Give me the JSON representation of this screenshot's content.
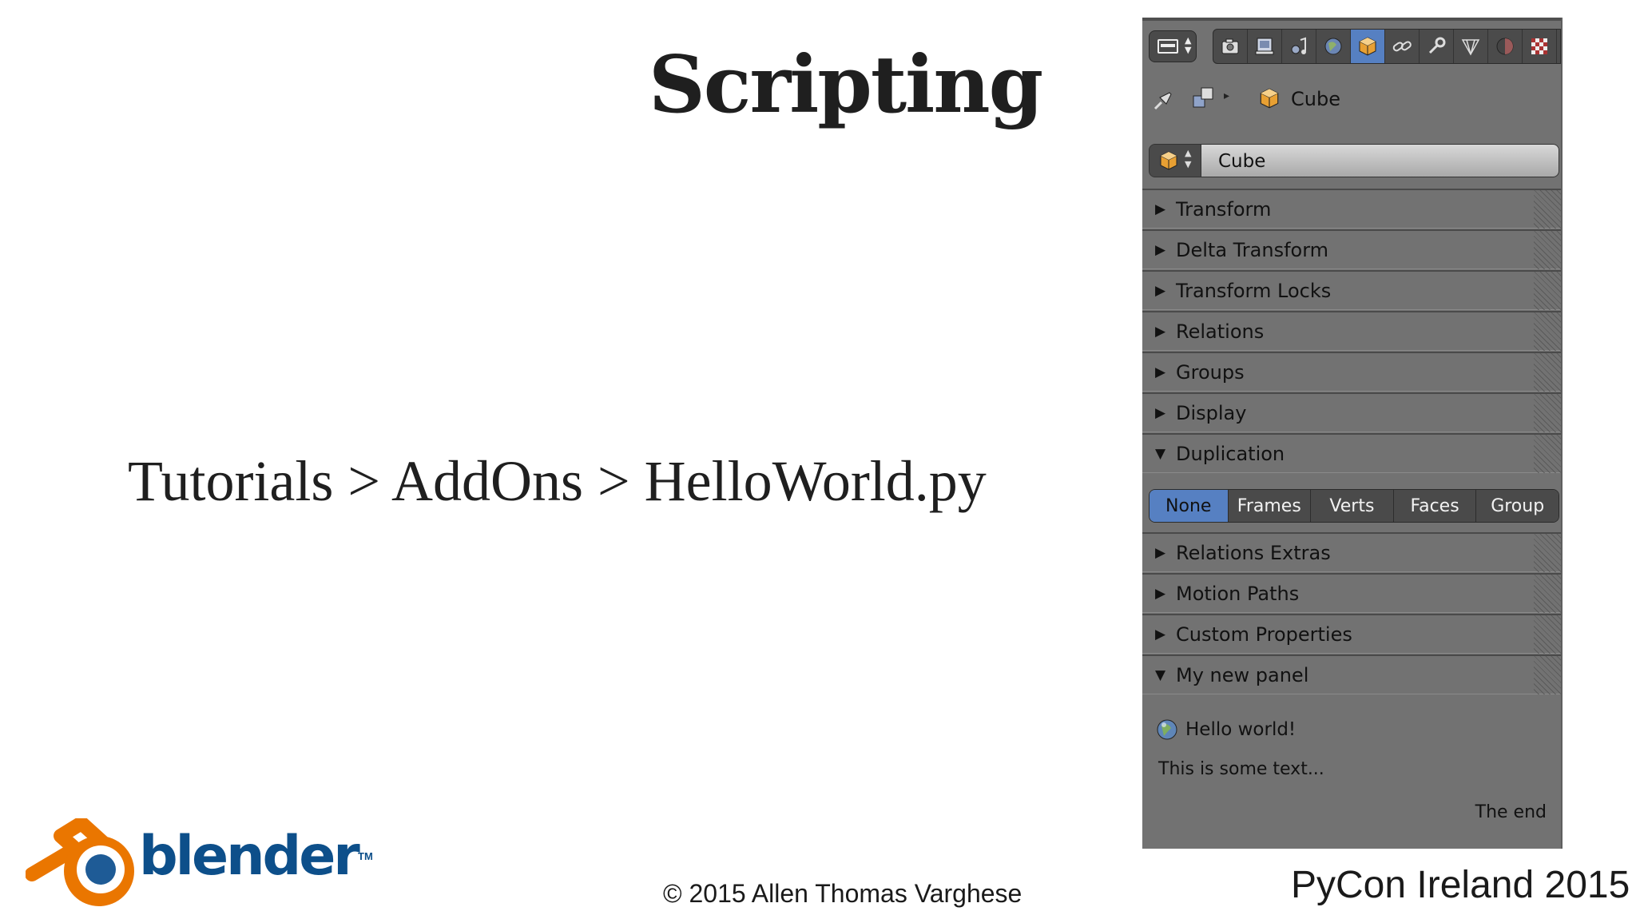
{
  "slide": {
    "title": "Scripting",
    "breadcrumb": "Tutorials > AddOns > HelloWorld.py",
    "copyright": "© 2015 Allen Thomas Varghese",
    "conference": "PyCon Ireland 2015",
    "logo_text": "blender",
    "logo_tm": "TM"
  },
  "properties_panel": {
    "context_object": "Cube",
    "object_field_value": "Cube",
    "tabs": [
      {
        "icon": "render-icon",
        "active": false
      },
      {
        "icon": "render-layers-icon",
        "active": false
      },
      {
        "icon": "scene-icon",
        "active": false
      },
      {
        "icon": "world-icon",
        "active": false
      },
      {
        "icon": "object-icon",
        "active": true
      },
      {
        "icon": "constraints-icon",
        "active": false
      },
      {
        "icon": "modifiers-icon",
        "active": false
      },
      {
        "icon": "data-icon",
        "active": false
      },
      {
        "icon": "material-icon",
        "active": false
      },
      {
        "icon": "texture-icon",
        "active": false
      }
    ],
    "sections": [
      {
        "label": "Transform",
        "expanded": false
      },
      {
        "label": "Delta Transform",
        "expanded": false
      },
      {
        "label": "Transform Locks",
        "expanded": false
      },
      {
        "label": "Relations",
        "expanded": false
      },
      {
        "label": "Groups",
        "expanded": false
      },
      {
        "label": "Display",
        "expanded": false
      },
      {
        "label": "Duplication",
        "expanded": true
      },
      {
        "label": "Relations Extras",
        "expanded": false
      },
      {
        "label": "Motion Paths",
        "expanded": false
      },
      {
        "label": "Custom Properties",
        "expanded": false
      },
      {
        "label": "My new panel",
        "expanded": true
      }
    ],
    "duplication_options": [
      "None",
      "Frames",
      "Verts",
      "Faces",
      "Group"
    ],
    "duplication_selected": "None",
    "my_panel": {
      "hello_label": "Hello world!",
      "text": "This is some text...",
      "end_text": "The end"
    },
    "colors": {
      "panel_bg": "#727272",
      "button_bg": "#4a4a4a",
      "active_blue": "#5680c2",
      "cube_orange": "#e8a033"
    }
  }
}
